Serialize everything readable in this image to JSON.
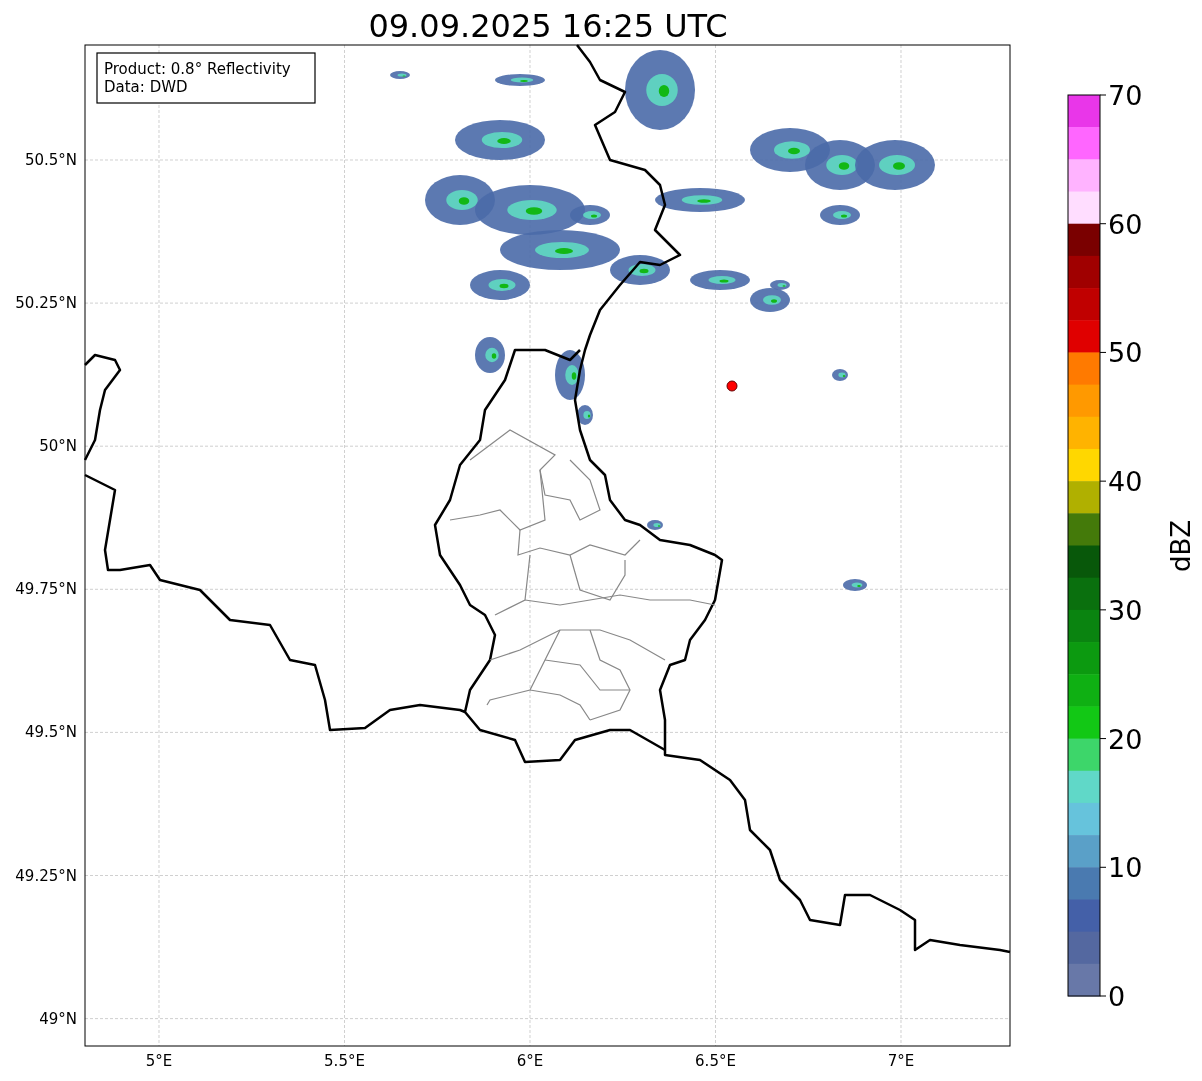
{
  "title": "09.09.2025 16:25 UTC",
  "legend": [
    "Product: 0.8° Reflectivity",
    "Data: DWD"
  ],
  "lat_ticks": [
    "50.5°N",
    "50.25°N",
    "50°N",
    "49.75°N",
    "49.5°N",
    "49.25°N",
    "49°N"
  ],
  "lon_ticks": [
    "5°E",
    "5.5°E",
    "6°E",
    "6.5°E",
    "7°E"
  ],
  "colorbar": {
    "label": "dBZ",
    "ticks": [
      "70",
      "60",
      "50",
      "40",
      "30",
      "20",
      "10",
      "0"
    ],
    "bins": [
      {
        "color": "#e936e9"
      },
      {
        "color": "#ff66ff"
      },
      {
        "color": "#ffb3ff"
      },
      {
        "color": "#ffddff"
      },
      {
        "color": "#7a0000"
      },
      {
        "color": "#a00000"
      },
      {
        "color": "#c00000"
      },
      {
        "color": "#e00000"
      },
      {
        "color": "#ff7a00"
      },
      {
        "color": "#ff9900"
      },
      {
        "color": "#ffb300"
      },
      {
        "color": "#ffd700"
      },
      {
        "color": "#b0b000"
      },
      {
        "color": "#447a0a"
      },
      {
        "color": "#08580a"
      },
      {
        "color": "#0a700e"
      },
      {
        "color": "#0a8410"
      },
      {
        "color": "#0c9a10"
      },
      {
        "color": "#0fb013"
      },
      {
        "color": "#12c815"
      },
      {
        "color": "#3dd66a"
      },
      {
        "color": "#60d8c8"
      },
      {
        "color": "#66c3dc"
      },
      {
        "color": "#5aa0c8"
      },
      {
        "color": "#4a7ab0"
      },
      {
        "color": "#4460a8"
      },
      {
        "color": "#5468a0"
      },
      {
        "color": "#6878a8"
      }
    ]
  }
}
